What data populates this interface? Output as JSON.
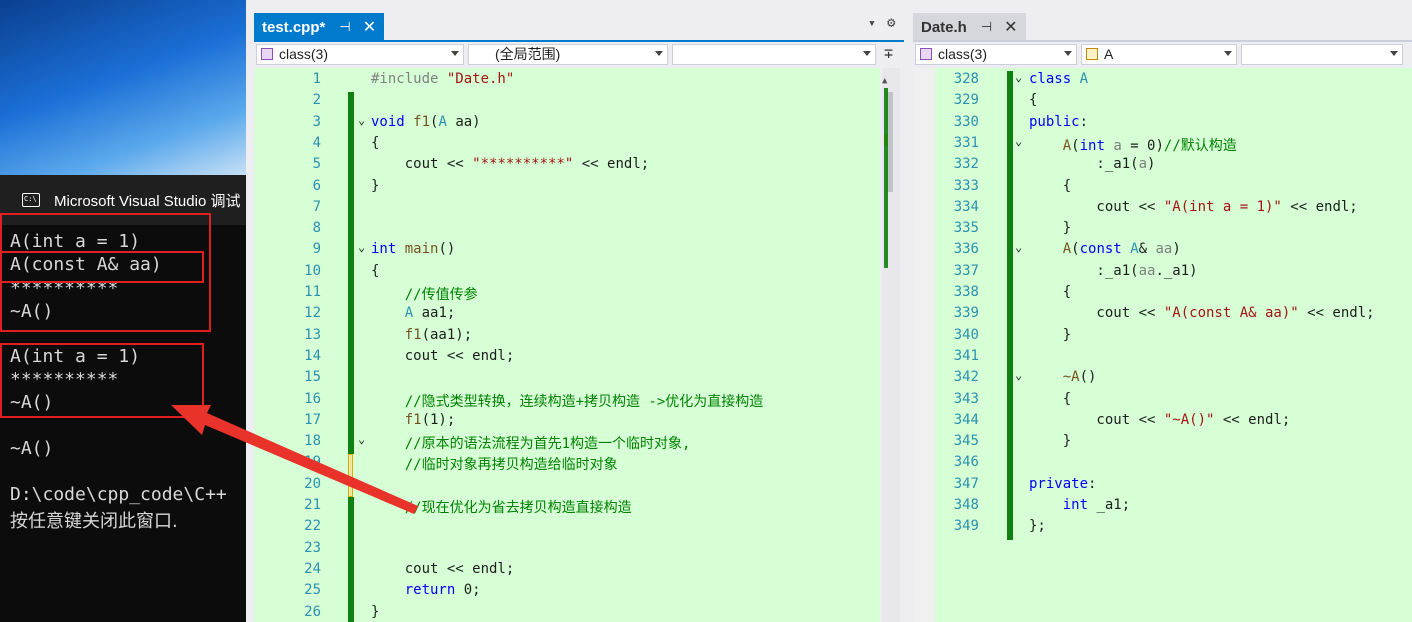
{
  "console": {
    "title": "Microsoft Visual Studio 调试",
    "lines": [
      "A(int a = 1)",
      "A(const A& aa)",
      "**********",
      "~A()",
      "A(int a = 1)",
      "**********",
      "~A()",
      "~A()",
      "D:\\code\\cpp_code\\C++",
      "按任意键关闭此窗口. "
    ]
  },
  "left_editor": {
    "tab_title": "test.cpp*",
    "tab_pin": "⊣",
    "tab_close": "✕",
    "dropdown_arrow": "▾",
    "gear": "⚙",
    "nav_class": "class(3)",
    "nav_scope": "(全局范围)",
    "nav_member": "",
    "split": "∓",
    "lines": [
      {
        "n": "1",
        "html": "<span class='pp'>#include </span><span class='st'>\"Date.h\"</span>"
      },
      {
        "n": "2",
        "html": ""
      },
      {
        "n": "3",
        "html": "<span class='kw'>void</span> <span class='fn'>f1</span>(<span class='ty'>A</span> aa)"
      },
      {
        "n": "4",
        "html": "{"
      },
      {
        "n": "5",
        "html": "    cout &lt;&lt; <span class='st'>\"**********\"</span> &lt;&lt; endl;"
      },
      {
        "n": "6",
        "html": "}"
      },
      {
        "n": "7",
        "html": ""
      },
      {
        "n": "8",
        "html": ""
      },
      {
        "n": "9",
        "html": "<span class='kw'>int</span> <span class='fn'>main</span>()"
      },
      {
        "n": "10",
        "html": "{"
      },
      {
        "n": "11",
        "html": "    <span class='cm'>//传值传参</span>"
      },
      {
        "n": "12",
        "html": "    <span class='ty'>A</span> aa1;"
      },
      {
        "n": "13",
        "html": "    <span class='fn'>f1</span>(aa1);"
      },
      {
        "n": "14",
        "html": "    cout &lt;&lt; endl;"
      },
      {
        "n": "15",
        "html": ""
      },
      {
        "n": "16",
        "html": "    <span class='cm'>//隐式类型转换，连续构造+拷贝构造 -&gt;优化为直接构造</span>"
      },
      {
        "n": "17",
        "html": "    <span class='fn'>f1</span>(1);"
      },
      {
        "n": "18",
        "html": "    <span class='cm'>//原本的语法流程为首先1构造一个临时对象,</span>"
      },
      {
        "n": "19",
        "html": "    <span class='cm'>//临时对象再拷贝构造给临时对象</span>"
      },
      {
        "n": "20",
        "html": ""
      },
      {
        "n": "21",
        "html": "    <span class='cm'>//现在优化为省去拷贝构造直接构造</span>"
      },
      {
        "n": "22",
        "html": ""
      },
      {
        "n": "23",
        "html": ""
      },
      {
        "n": "24",
        "html": "    cout &lt;&lt; endl;"
      },
      {
        "n": "25",
        "html": "    <span class='kw'>return</span> 0;"
      },
      {
        "n": "26",
        "html": "}"
      }
    ]
  },
  "right_editor": {
    "tab_title": "Date.h",
    "tab_pin": "⊣",
    "tab_close": "✕",
    "nav_class": "class(3)",
    "nav_scope": "A",
    "nav_member": "",
    "lines": [
      {
        "n": "328",
        "html": "<span class='kw'>class</span> <span class='ty'>A</span>"
      },
      {
        "n": "329",
        "html": "{"
      },
      {
        "n": "330",
        "html": "<span class='kw'>public</span>:"
      },
      {
        "n": "331",
        "html": "    <span class='fn'>A</span>(<span class='kw'>int</span> <span class='pp'>a</span> = 0)<span class='cm'>//默认构造</span>"
      },
      {
        "n": "332",
        "html": "        :_a1(<span class='pp'>a</span>)"
      },
      {
        "n": "333",
        "html": "    {"
      },
      {
        "n": "334",
        "html": "        cout &lt;&lt; <span class='st'>\"A(int a = 1)\"</span> &lt;&lt; endl;"
      },
      {
        "n": "335",
        "html": "    }"
      },
      {
        "n": "336",
        "html": "    <span class='fn'>A</span>(<span class='kw'>const</span> <span class='ty'>A</span>&amp; <span class='pp'>aa</span>)"
      },
      {
        "n": "337",
        "html": "        :_a1(<span class='pp'>aa</span>._a1)"
      },
      {
        "n": "338",
        "html": "    {"
      },
      {
        "n": "339",
        "html": "        cout &lt;&lt; <span class='st'>\"A(const A&amp; aa)\"</span> &lt;&lt; endl;"
      },
      {
        "n": "340",
        "html": "    }"
      },
      {
        "n": "341",
        "html": ""
      },
      {
        "n": "342",
        "html": "    <span class='fn'>~A</span>()"
      },
      {
        "n": "343",
        "html": "    {"
      },
      {
        "n": "344",
        "html": "        cout &lt;&lt; <span class='st'>\"~A()\"</span> &lt;&lt; endl;"
      },
      {
        "n": "345",
        "html": "    }"
      },
      {
        "n": "346",
        "html": ""
      },
      {
        "n": "347",
        "html": "<span class='kw'>private</span>:"
      },
      {
        "n": "348",
        "html": "    <span class='kw'>int</span> _a1;"
      },
      {
        "n": "349",
        "html": "};"
      }
    ]
  },
  "colors": {
    "accent": "#007acc",
    "highlight_red": "#e02020",
    "code_bg": "#d6ffd6",
    "change_green": "#108010"
  }
}
